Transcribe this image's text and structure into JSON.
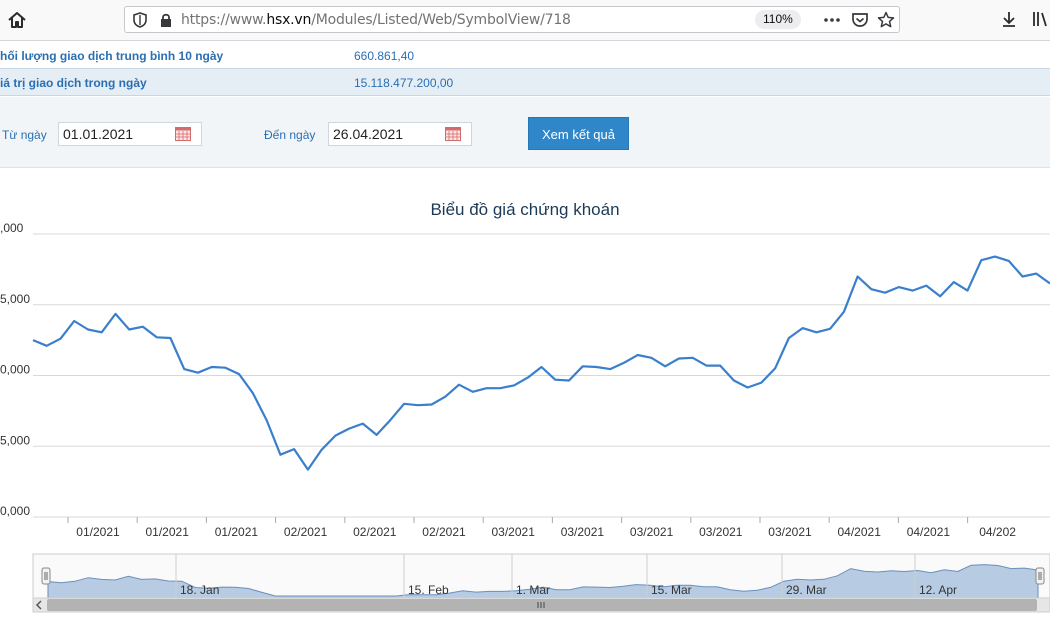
{
  "browser": {
    "url_prefix": "https://www.",
    "url_domain": "hsx.vn",
    "url_path": "/Modules/Listed/Web/SymbolView/718",
    "zoom": "110%"
  },
  "info": {
    "avg_volume_label": "hối lượng giao dịch trung bình 10 ngày",
    "avg_volume_value": "660.861,40",
    "day_value_label": "iá trị giao dịch trong ngày",
    "day_value_value": "15.118.477.200,00"
  },
  "filter": {
    "from_label": "Từ ngày",
    "from_value": "01.01.2021",
    "to_label": "Đến ngày",
    "to_value": "26.04.2021",
    "submit_label": "Xem kết quả"
  },
  "chart_data": {
    "type": "line",
    "title": "Biểu đồ giá chứng khoán",
    "y_tick_labels": [
      ",000",
      "5,000",
      "0,000",
      "5,000",
      "0,000"
    ],
    "x_tick_labels": [
      "01/2021",
      "01/2021",
      "01/2021",
      "02/2021",
      "02/2021",
      "02/2021",
      "03/2021",
      "03/2021",
      "03/2021",
      "03/2021",
      "03/2021",
      "04/2021",
      "04/2021",
      "04/202"
    ],
    "navigator_labels": [
      "18. Jan",
      "15. Feb",
      "1. Mar",
      "15. Mar",
      "29. Mar",
      "12. Apr"
    ],
    "y_levels": [
      4,
      3,
      2,
      1,
      0
    ],
    "ylim": [
      0,
      4
    ],
    "y": [
      2.5,
      2.42,
      2.52,
      2.77,
      2.65,
      2.61,
      2.87,
      2.65,
      2.69,
      2.54,
      2.53,
      2.09,
      2.04,
      2.12,
      2.11,
      2.02,
      1.75,
      1.37,
      0.88,
      0.96,
      0.67,
      0.95,
      1.15,
      1.25,
      1.32,
      1.16,
      1.37,
      1.6,
      1.58,
      1.59,
      1.7,
      1.87,
      1.77,
      1.82,
      1.82,
      1.86,
      1.97,
      2.12,
      1.94,
      1.93,
      2.13,
      2.12,
      2.09,
      2.18,
      2.29,
      2.25,
      2.13,
      2.24,
      2.25,
      2.14,
      2.14,
      1.93,
      1.83,
      1.9,
      2.1,
      2.53,
      2.67,
      2.61,
      2.66,
      2.9,
      3.4,
      3.22,
      3.17,
      3.25,
      3.2,
      3.27,
      3.12,
      3.32,
      3.2,
      3.63,
      3.68,
      3.62,
      3.4,
      3.44,
      3.3
    ],
    "line_color": "#3a7fcc",
    "navigator_fill": "#b7cbe2"
  }
}
